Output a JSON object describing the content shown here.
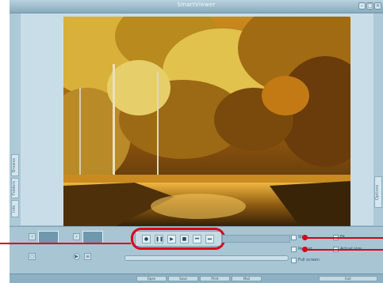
{
  "app": {
    "title": "SmartViewer"
  },
  "sidebar_left": {
    "tabs": [
      "Browse",
      "Folders",
      "Info"
    ]
  },
  "sidebar_right": {
    "tabs": [
      "Options"
    ]
  },
  "photo": {
    "subject": "autumn forest reflected in river",
    "description_hidden": true
  },
  "transport": {
    "buttons": [
      {
        "name": "record",
        "glyph": "●"
      },
      {
        "name": "pause",
        "glyph": "❚❚"
      },
      {
        "name": "play",
        "glyph": "▶"
      },
      {
        "name": "stop",
        "glyph": "■"
      },
      {
        "name": "previous",
        "glyph": "⏮"
      },
      {
        "name": "next",
        "glyph": "⏭"
      }
    ]
  },
  "options": {
    "labels": [
      "Slide",
      "Repeat",
      "Full screen",
      "Fit",
      "Actual size"
    ]
  },
  "statusbar": {
    "buttons": [
      "Open",
      "Save",
      "Print",
      "Mail",
      "Exit"
    ]
  },
  "colors": {
    "accent": "#d9001b",
    "chrome": "#9fbfd0",
    "titlebar": "#88aabd"
  }
}
